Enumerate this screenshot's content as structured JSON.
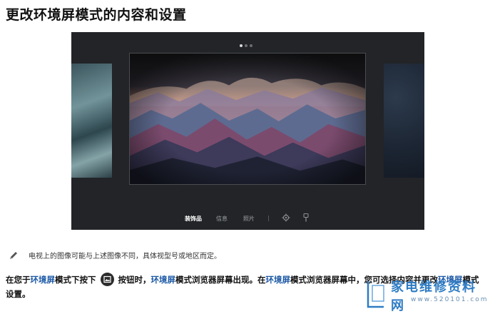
{
  "heading": "更改环境屏模式的内容和设置",
  "tv_ui": {
    "carousel_dots": [
      {
        "active": true
      },
      {
        "active": false
      },
      {
        "active": false
      }
    ],
    "menu": {
      "decor_label": "装饰品",
      "info_label": "信息",
      "photos_label": "照片",
      "separator": "|",
      "icons": [
        "settings-icon",
        "brush-icon"
      ]
    }
  },
  "note": {
    "icon": "pencil-icon",
    "text": "电视上的图像可能与上述图像不同，具体视型号或地区而定。"
  },
  "paragraph": {
    "p1": "在您于",
    "hl1": "环境屏",
    "p2": "模式下按下",
    "p3": "按钮时，",
    "hl2": "环境屏",
    "p4": "模式浏览器屏幕出现。在",
    "hl3": "环境屏",
    "p5": "模式浏览器屏幕中，您可选择内容并更改",
    "hl4": "环境屏",
    "p6": "模式设置。"
  },
  "watermark": {
    "text": "家电维修资料网",
    "url": "www.520101.com"
  },
  "colors": {
    "highlight": "#1a57a5",
    "screen_bg": "#222427",
    "watermark": "#2f7cc4"
  }
}
